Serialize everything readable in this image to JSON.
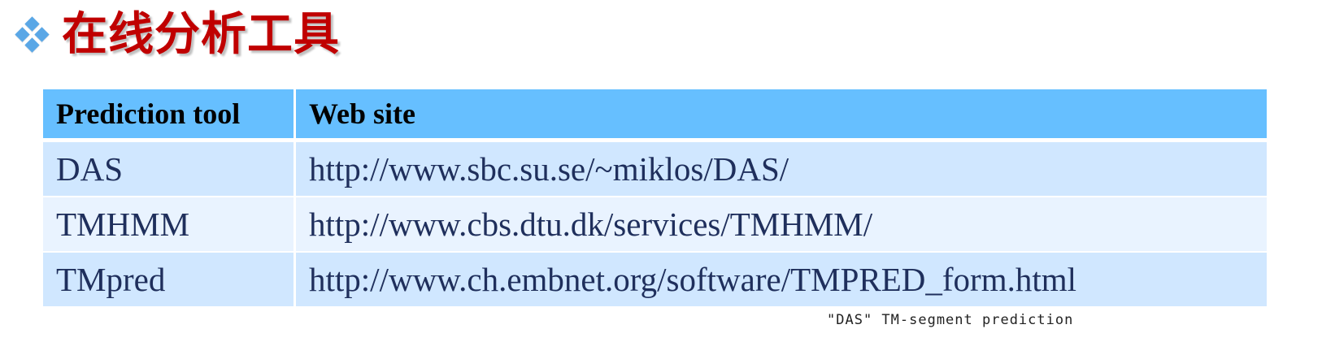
{
  "slide": {
    "title": "在线分析工具",
    "bullet_icon": "diamond-bullet-icon",
    "title_color": "#c00000"
  },
  "table": {
    "headers": {
      "tool": "Prediction tool",
      "site": "Web site"
    },
    "rows": [
      {
        "tool": "DAS",
        "site": "http://www.sbc.su.se/~miklos/DAS/"
      },
      {
        "tool": "TMHMM",
        "site": "http://www.cbs.dtu.dk/services/TMHMM/"
      },
      {
        "tool": "TMpred",
        "site": "http://www.ch.embnet.org/software/TMPRED_form.html"
      }
    ],
    "colors": {
      "header_bg": "#66bfff",
      "row_odd_bg": "#d0e7ff",
      "row_even_bg": "#e9f3ff",
      "text": "#1f2f5c"
    }
  },
  "caption": "\"DAS\" TM-segment prediction"
}
